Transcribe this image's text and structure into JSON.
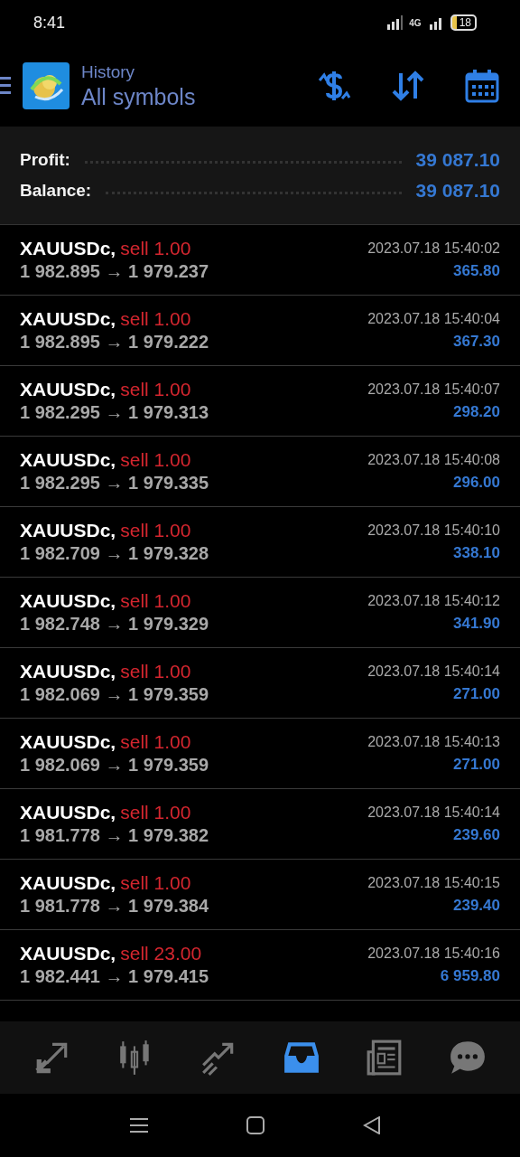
{
  "status_bar": {
    "time": "8:41",
    "network": "4G",
    "battery": "18"
  },
  "header": {
    "title": "History",
    "subtitle": "All symbols"
  },
  "summary": [
    {
      "label": "Profit:",
      "value": "39 087.10"
    },
    {
      "label": "Balance:",
      "value": "39 087.10"
    }
  ],
  "deals": [
    {
      "symbol": "XAUUSDc,",
      "action": "sell 1.00",
      "prices": "1 982.895 → 1 979.237",
      "time": "2023.07.18 15:40:02",
      "profit": "365.80"
    },
    {
      "symbol": "XAUUSDc,",
      "action": "sell 1.00",
      "prices": "1 982.895 → 1 979.222",
      "time": "2023.07.18 15:40:04",
      "profit": "367.30"
    },
    {
      "symbol": "XAUUSDc,",
      "action": "sell 1.00",
      "prices": "1 982.295 → 1 979.313",
      "time": "2023.07.18 15:40:07",
      "profit": "298.20"
    },
    {
      "symbol": "XAUUSDc,",
      "action": "sell 1.00",
      "prices": "1 982.295 → 1 979.335",
      "time": "2023.07.18 15:40:08",
      "profit": "296.00"
    },
    {
      "symbol": "XAUUSDc,",
      "action": "sell 1.00",
      "prices": "1 982.709 → 1 979.328",
      "time": "2023.07.18 15:40:10",
      "profit": "338.10"
    },
    {
      "symbol": "XAUUSDc,",
      "action": "sell 1.00",
      "prices": "1 982.748 → 1 979.329",
      "time": "2023.07.18 15:40:12",
      "profit": "341.90"
    },
    {
      "symbol": "XAUUSDc,",
      "action": "sell 1.00",
      "prices": "1 982.069 → 1 979.359",
      "time": "2023.07.18 15:40:14",
      "profit": "271.00"
    },
    {
      "symbol": "XAUUSDc,",
      "action": "sell 1.00",
      "prices": "1 982.069 → 1 979.359",
      "time": "2023.07.18 15:40:13",
      "profit": "271.00"
    },
    {
      "symbol": "XAUUSDc,",
      "action": "sell 1.00",
      "prices": "1 981.778 → 1 979.382",
      "time": "2023.07.18 15:40:14",
      "profit": "239.60"
    },
    {
      "symbol": "XAUUSDc,",
      "action": "sell 1.00",
      "prices": "1 981.778 → 1 979.384",
      "time": "2023.07.18 15:40:15",
      "profit": "239.40"
    },
    {
      "symbol": "XAUUSDc,",
      "action": "sell 23.00",
      "prices": "1 982.441 → 1 979.415",
      "time": "2023.07.18 15:40:16",
      "profit": "6 959.80"
    }
  ],
  "bottom_nav": [
    {
      "kind": "quotes",
      "selected": false
    },
    {
      "kind": "chart",
      "selected": false
    },
    {
      "kind": "trade",
      "selected": false
    },
    {
      "kind": "history",
      "selected": true
    },
    {
      "kind": "news",
      "selected": false
    },
    {
      "kind": "chat",
      "selected": false
    }
  ]
}
